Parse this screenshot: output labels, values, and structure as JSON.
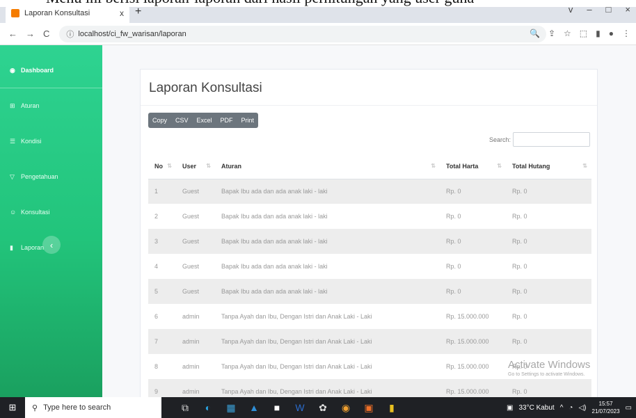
{
  "doc_caption": "Menu ini berisi laporan-laporan dari hasil perhitungan yang user guna",
  "browser": {
    "tab_title": "Laporan Konsultasi",
    "tab_close": "x",
    "new_tab": "+",
    "url": "localhost/ci_fw_warisan/laporan",
    "win_controls": [
      "v",
      "–",
      "□",
      "×"
    ]
  },
  "sidebar": {
    "items": [
      {
        "label": "Dashboard",
        "icon": "dashboard-icon",
        "active": true
      },
      {
        "label": "Aturan",
        "icon": "grid-icon",
        "active": false
      },
      {
        "label": "Kondisi",
        "icon": "list-icon",
        "active": false
      },
      {
        "label": "Pengetahuan",
        "icon": "filter-icon",
        "active": false
      },
      {
        "label": "Konsultasi",
        "icon": "users-icon",
        "active": false
      },
      {
        "label": "Laporan",
        "icon": "report-icon",
        "active": false
      }
    ],
    "toggle": "‹"
  },
  "main": {
    "title": "Laporan Konsultasi",
    "export_buttons": [
      "Copy",
      "CSV",
      "Excel",
      "PDF",
      "Print"
    ],
    "search_label": "Search:",
    "columns": [
      "No",
      "User",
      "Aturan",
      "Total Harta",
      "Total Hutang"
    ],
    "rows": [
      {
        "no": "1",
        "user": "Guest",
        "aturan": "Bapak Ibu ada dan ada anak laki - laki",
        "harta": "Rp. 0",
        "hutang": "Rp. 0"
      },
      {
        "no": "2",
        "user": "Guest",
        "aturan": "Bapak Ibu ada dan ada anak laki - laki",
        "harta": "Rp. 0",
        "hutang": "Rp. 0"
      },
      {
        "no": "3",
        "user": "Guest",
        "aturan": "Bapak Ibu ada dan ada anak laki - laki",
        "harta": "Rp. 0",
        "hutang": "Rp. 0"
      },
      {
        "no": "4",
        "user": "Guest",
        "aturan": "Bapak Ibu ada dan ada anak laki - laki",
        "harta": "Rp. 0",
        "hutang": "Rp. 0"
      },
      {
        "no": "5",
        "user": "Guest",
        "aturan": "Bapak Ibu ada dan ada anak laki - laki",
        "harta": "Rp. 0",
        "hutang": "Rp. 0"
      },
      {
        "no": "6",
        "user": "admin",
        "aturan": "Tanpa Ayah dan Ibu, Dengan Istri dan Anak Laki - Laki",
        "harta": "Rp. 15.000.000",
        "hutang": "Rp. 0"
      },
      {
        "no": "7",
        "user": "admin",
        "aturan": "Tanpa Ayah dan Ibu, Dengan Istri dan Anak Laki - Laki",
        "harta": "Rp. 15.000.000",
        "hutang": "Rp. 0"
      },
      {
        "no": "8",
        "user": "admin",
        "aturan": "Tanpa Ayah dan Ibu, Dengan Istri dan Anak Laki - Laki",
        "harta": "Rp. 15.000.000",
        "hutang": "Rp. 0"
      },
      {
        "no": "9",
        "user": "admin",
        "aturan": "Tanpa Ayah dan Ibu, Dengan Istri dan Anak Laki - Laki",
        "harta": "Rp. 15.000.000",
        "hutang": "Rp. 0"
      }
    ]
  },
  "watermark": {
    "title": "Activate Windows",
    "subtitle": "Go to Settings to activate Windows."
  },
  "taskbar": {
    "search_placeholder": "Type here to search",
    "weather": "33°C Kabut",
    "time": "15:57",
    "date": "21/07/2023"
  },
  "colors": {
    "sidebar_green": "#22c47b",
    "button_gray": "#6c757d",
    "row_stripe": "#ededed"
  }
}
